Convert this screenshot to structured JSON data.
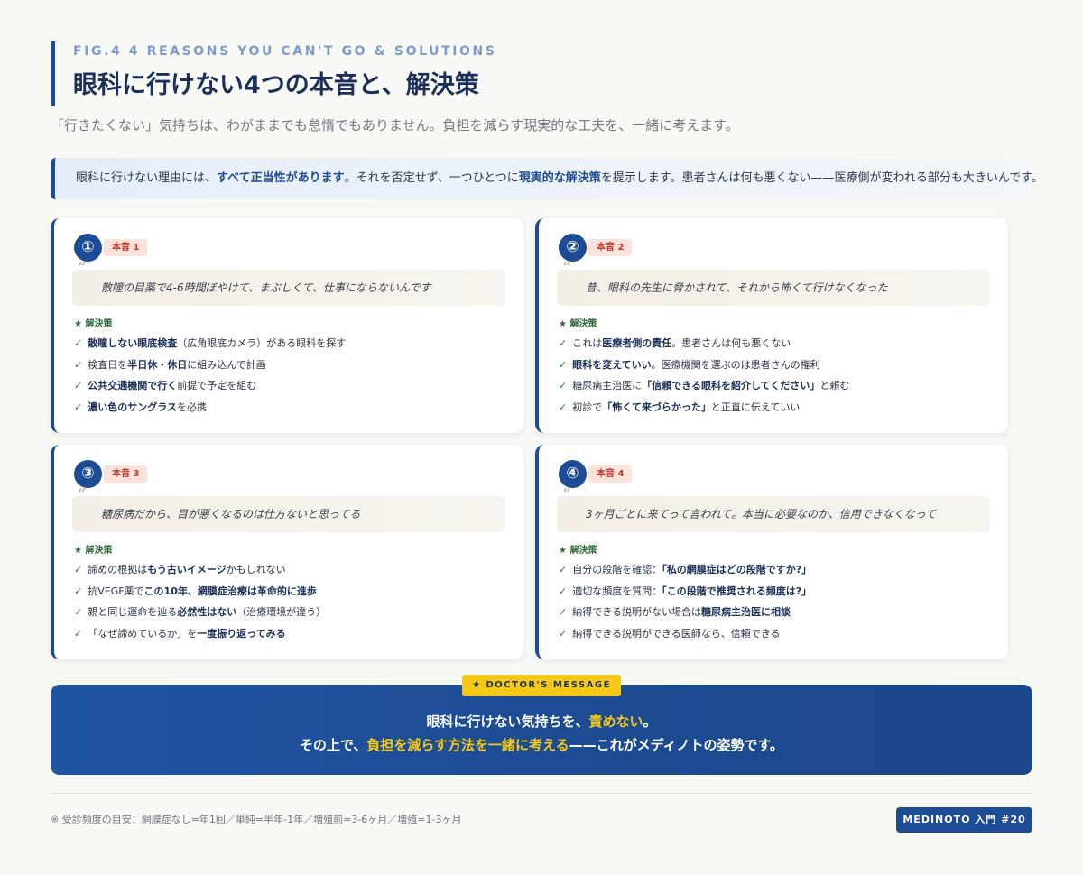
{
  "header": {
    "fig_label": "FIG.4 4 REASONS YOU CAN'T GO & SOLUTIONS",
    "title": "眼科に行けない4つの本音と、解決策",
    "subtitle": "「行きたくない」気持ちは、わがままでも怠惰でもありません。負担を減らす現実的な工夫を、一緒に考えます。"
  },
  "notice": {
    "p1": "眼科に行けない理由には、",
    "b1": "すべて正当性があります",
    "p2": "。それを否定せず、一つひとつに",
    "b2": "現実的な解決策",
    "p3": "を提示します。患者さんは何も悪くない——医療側が変われる部分も大きいんです。"
  },
  "cards": [
    {
      "num": "①",
      "badge": "本音 1",
      "quote_mark": "“",
      "quote": "散瞳の目薬で4-6時間ぼやけて、まぶしくて、仕事にならないんです",
      "solution_label": "★ 解決策",
      "items": [
        {
          "check": "✓",
          "bold1": "散瞳しない眼底検査",
          "text1": "（広角眼底カメラ）がある眼科を探す",
          "bold2": "",
          "text2": ""
        },
        {
          "check": "✓",
          "bold1": "",
          "text1": "検査日を",
          "bold2": "半日休・休日",
          "text2": "に組み込んで計画"
        },
        {
          "check": "✓",
          "bold1": "公共交通機関で行く",
          "text1": "前提で予定を組む",
          "bold2": "",
          "text2": ""
        },
        {
          "check": "✓",
          "bold1": "濃い色のサングラス",
          "text1": "を必携",
          "bold2": "",
          "text2": ""
        }
      ]
    },
    {
      "num": "②",
      "badge": "本音 2",
      "quote_mark": "“",
      "quote": "昔、眼科の先生に脅かされて、それから怖くて行けなくなった",
      "solution_label": "★ 解決策",
      "items": [
        {
          "check": "✓",
          "bold1": "",
          "text1": "これは",
          "bold2": "医療者側の責任",
          "text2": "。患者さんは何も悪くない"
        },
        {
          "check": "✓",
          "bold1": "眼科を変えていい",
          "text1": "。医療機関を選ぶのは患者さんの権利",
          "bold2": "",
          "text2": ""
        },
        {
          "check": "✓",
          "bold1": "",
          "text1": "糖尿病主治医に",
          "bold2": "「信頼できる眼科を紹介してください」",
          "text2": "と頼む"
        },
        {
          "check": "✓",
          "bold1": "",
          "text1": "初診で",
          "bold2": "「怖くて来づらかった」",
          "text2": "と正直に伝えていい"
        }
      ]
    },
    {
      "num": "③",
      "badge": "本音 3",
      "quote_mark": "“",
      "quote": "糖尿病だから、目が悪くなるのは仕方ないと思ってる",
      "solution_label": "★ 解決策",
      "items": [
        {
          "check": "✓",
          "bold1": "",
          "text1": "諦めの根拠は",
          "bold2": "もう古いイメージ",
          "text2": "かもしれない"
        },
        {
          "check": "✓",
          "bold1": "",
          "text1": "抗VEGF薬で",
          "bold2": "この10年、網膜症治療は革命的に進歩",
          "text2": ""
        },
        {
          "check": "✓",
          "bold1": "",
          "text1": "親と同じ運命を辿る",
          "bold2": "必然性はない",
          "text2": "（治療環境が違う）"
        },
        {
          "check": "✓",
          "bold1": "",
          "text1": "「なぜ諦めているか」を",
          "bold2": "一度振り返ってみる",
          "text2": ""
        }
      ]
    },
    {
      "num": "④",
      "badge": "本音 4",
      "quote_mark": "“",
      "quote": "3ヶ月ごとに来てって言われて。本当に必要なのか、信用できなくなって",
      "solution_label": "★ 解決策",
      "items": [
        {
          "check": "✓",
          "bold1": "",
          "text1": "自分の段階を確認：",
          "bold2": "「私の網膜症はどの段階ですか?」",
          "text2": ""
        },
        {
          "check": "✓",
          "bold1": "",
          "text1": "適切な頻度を質問：",
          "bold2": "「この段階で推奨される頻度は?」",
          "text2": ""
        },
        {
          "check": "✓",
          "bold1": "",
          "text1": "納得できる説明がない場合は",
          "bold2": "糖尿病主治医に相談",
          "text2": ""
        },
        {
          "check": "✓",
          "bold1": "",
          "text1": "納得できる説明ができる医師なら、信頼できる",
          "bold2": "",
          "text2": ""
        }
      ]
    }
  ],
  "doctor": {
    "tag": "★ DOCTOR'S MESSAGE",
    "line1_a": "眼科に行けない気持ちを、",
    "line1_hl": "責めない",
    "line1_b": "。",
    "line2_a": "その上で、",
    "line2_hl": "負担を減らす方法を一緒に考える",
    "line2_b": "——これがメディノトの姿勢です。"
  },
  "footer": {
    "note": "※ 受診頻度の目安：網膜症なし=年1回／単純=半年-1年／増殖前=3-6ヶ月／増殖=1-3ヶ月",
    "badge": "MEDINOTO 入門 #20"
  }
}
